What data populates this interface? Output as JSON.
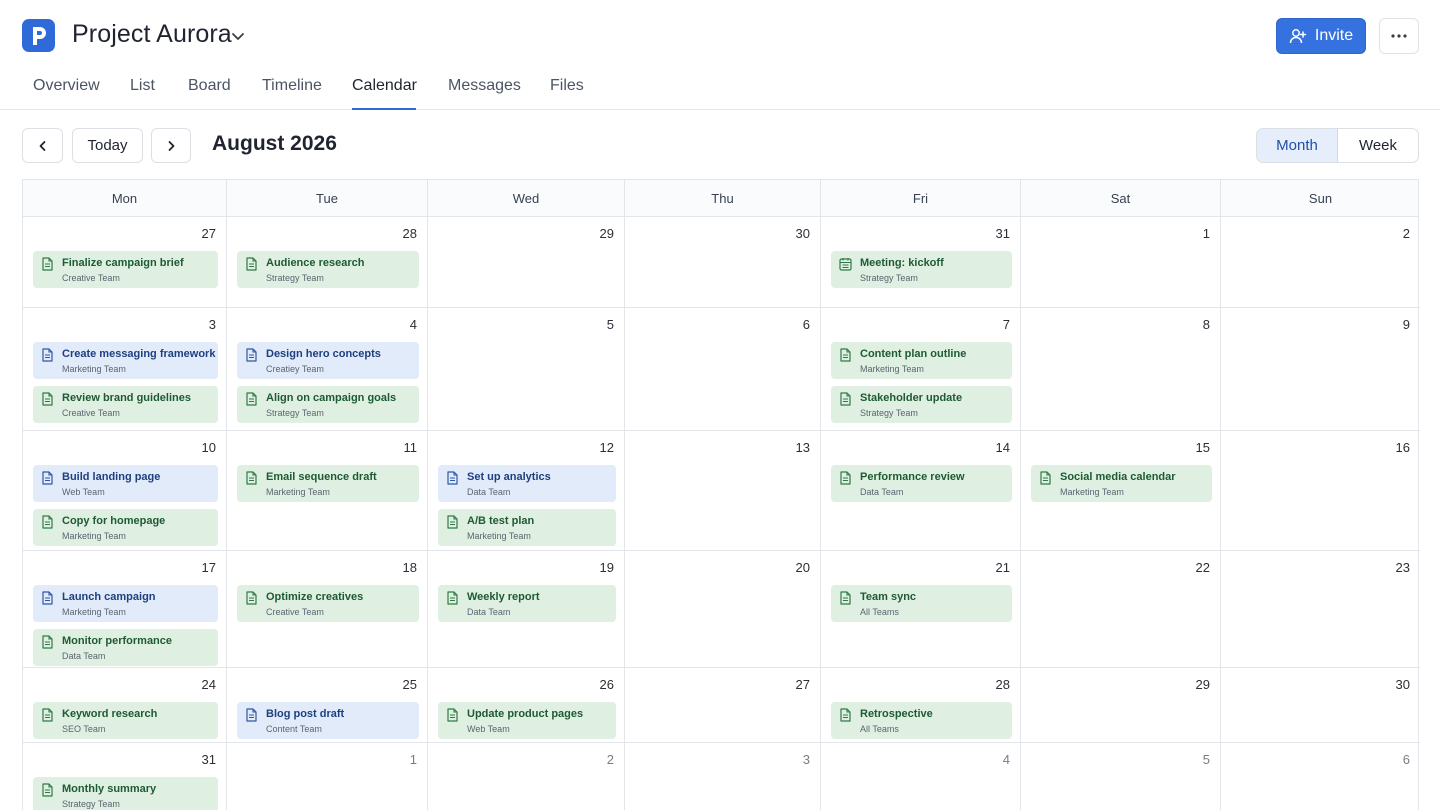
{
  "app": {
    "project_name": "Project Aurora",
    "invite_label": "Invite",
    "accent_color": "#3571df",
    "event_green": "#dff0e2",
    "event_blue": "#e2ebf9"
  },
  "tabs": [
    {
      "label": "Overview",
      "active": false
    },
    {
      "label": "List",
      "active": false
    },
    {
      "label": "Board",
      "active": false
    },
    {
      "label": "Timeline",
      "active": false
    },
    {
      "label": "Calendar",
      "active": true
    },
    {
      "label": "Messages",
      "active": false
    },
    {
      "label": "Files",
      "active": false
    }
  ],
  "toolbar": {
    "today_label": "Today",
    "month_label": "August 2026",
    "view_options": [
      {
        "label": "Month",
        "active": true
      },
      {
        "label": "Week",
        "active": false
      }
    ]
  },
  "calendar": {
    "weekdays": [
      "Mon",
      "Tue",
      "Wed",
      "Thu",
      "Fri",
      "Sat",
      "Sun"
    ],
    "weeks": [
      [
        {
          "day": "27",
          "muted": false,
          "events": [
            {
              "title": "Finalize campaign brief",
              "team": "Creative Team",
              "color": "green",
              "icon": "document-icon"
            }
          ]
        },
        {
          "day": "28",
          "muted": false,
          "events": [
            {
              "title": "Audience research",
              "team": "Strategy Team",
              "color": "green",
              "icon": "document-icon"
            }
          ]
        },
        {
          "day": "29",
          "muted": false,
          "events": []
        },
        {
          "day": "30",
          "muted": false,
          "events": []
        },
        {
          "day": "31",
          "muted": false,
          "events": [
            {
              "title": "Meeting: kickoff",
              "team": "Strategy Team",
              "color": "green",
              "icon": "calendar-icon"
            }
          ]
        },
        {
          "day": "1",
          "muted": false,
          "events": []
        },
        {
          "day": "2",
          "muted": false,
          "events": []
        }
      ],
      [
        {
          "day": "3",
          "muted": false,
          "events": [
            {
              "title": "Create messaging framework",
              "team": "Marketing Team",
              "color": "blue",
              "icon": "document-icon"
            },
            {
              "title": "Review brand guidelines",
              "team": "Creative Team",
              "color": "green",
              "icon": "document-icon"
            }
          ]
        },
        {
          "day": "4",
          "muted": false,
          "events": [
            {
              "title": "Design hero concepts",
              "team": "Creatiey Team",
              "color": "blue",
              "icon": "document-icon"
            },
            {
              "title": "Align on campaign goals",
              "team": "Strategy Team",
              "color": "green",
              "icon": "document-icon"
            }
          ]
        },
        {
          "day": "5",
          "muted": false,
          "events": []
        },
        {
          "day": "6",
          "muted": false,
          "events": []
        },
        {
          "day": "7",
          "muted": false,
          "events": [
            {
              "title": "Content plan outline",
              "team": "Marketing Team",
              "color": "green",
              "icon": "document-icon"
            },
            {
              "title": "Stakeholder update",
              "team": "Strategy Team",
              "color": "green",
              "icon": "document-icon"
            }
          ]
        },
        {
          "day": "8",
          "muted": false,
          "events": []
        },
        {
          "day": "9",
          "muted": false,
          "events": []
        }
      ],
      [
        {
          "day": "10",
          "muted": false,
          "events": [
            {
              "title": "Build landing page",
              "team": "Web Team",
              "color": "blue",
              "icon": "document-icon"
            },
            {
              "title": "Copy for homepage",
              "team": "Marketing Team",
              "color": "green",
              "icon": "document-icon"
            }
          ]
        },
        {
          "day": "11",
          "muted": false,
          "events": [
            {
              "title": "Email sequence draft",
              "team": "Marketing Team",
              "color": "green",
              "icon": "document-icon"
            }
          ]
        },
        {
          "day": "12",
          "muted": false,
          "events": [
            {
              "title": "Set up analytics",
              "team": "Data Team",
              "color": "blue",
              "icon": "document-icon"
            },
            {
              "title": "A/B test plan",
              "team": "Marketing Team",
              "color": "green",
              "icon": "document-icon"
            }
          ]
        },
        {
          "day": "13",
          "muted": false,
          "events": []
        },
        {
          "day": "14",
          "muted": false,
          "events": [
            {
              "title": "Performance review",
              "team": "Data Team",
              "color": "green",
              "icon": "document-icon"
            }
          ]
        },
        {
          "day": "15",
          "muted": false,
          "events": [
            {
              "title": "Social media calendar",
              "team": "Marketing Team",
              "color": "green",
              "icon": "document-icon"
            }
          ]
        },
        {
          "day": "16",
          "muted": false,
          "events": []
        }
      ],
      [
        {
          "day": "17",
          "muted": false,
          "events": [
            {
              "title": "Launch campaign",
              "team": "Marketing Team",
              "color": "blue",
              "icon": "document-icon"
            },
            {
              "title": "Monitor performance",
              "team": "Data Team",
              "color": "green",
              "icon": "document-icon"
            }
          ]
        },
        {
          "day": "18",
          "muted": false,
          "events": [
            {
              "title": "Optimize creatives",
              "team": "Creative Team",
              "color": "green",
              "icon": "document-icon"
            }
          ]
        },
        {
          "day": "19",
          "muted": false,
          "events": [
            {
              "title": "Weekly report",
              "team": "Data Team",
              "color": "green",
              "icon": "document-icon"
            }
          ]
        },
        {
          "day": "20",
          "muted": false,
          "events": []
        },
        {
          "day": "21",
          "muted": false,
          "events": [
            {
              "title": "Team sync",
              "team": "All Teams",
              "color": "green",
              "icon": "document-icon"
            }
          ]
        },
        {
          "day": "22",
          "muted": false,
          "events": []
        },
        {
          "day": "23",
          "muted": false,
          "events": []
        }
      ],
      [
        {
          "day": "24",
          "muted": false,
          "events": [
            {
              "title": "Keyword research",
              "team": "SEO Team",
              "color": "green",
              "icon": "document-icon"
            }
          ]
        },
        {
          "day": "25",
          "muted": false,
          "events": [
            {
              "title": "Blog post draft",
              "team": "Content Team",
              "color": "blue",
              "icon": "document-icon"
            }
          ]
        },
        {
          "day": "26",
          "muted": false,
          "events": [
            {
              "title": "Update product pages",
              "team": "Web Team",
              "color": "green",
              "icon": "document-icon"
            }
          ]
        },
        {
          "day": "27",
          "muted": false,
          "events": []
        },
        {
          "day": "28",
          "muted": false,
          "events": [
            {
              "title": "Retrospective",
              "team": "All Teams",
              "color": "green",
              "icon": "document-icon"
            }
          ]
        },
        {
          "day": "29",
          "muted": false,
          "events": []
        },
        {
          "day": "30",
          "muted": false,
          "events": []
        }
      ],
      [
        {
          "day": "31",
          "muted": false,
          "events": [
            {
              "title": "Monthly summary",
              "team": "Strategy Team",
              "color": "green",
              "icon": "document-icon"
            }
          ]
        },
        {
          "day": "1",
          "muted": true,
          "events": []
        },
        {
          "day": "2",
          "muted": true,
          "events": []
        },
        {
          "day": "3",
          "muted": true,
          "events": []
        },
        {
          "day": "4",
          "muted": true,
          "events": []
        },
        {
          "day": "5",
          "muted": true,
          "events": []
        },
        {
          "day": "6",
          "muted": true,
          "events": []
        }
      ]
    ]
  }
}
